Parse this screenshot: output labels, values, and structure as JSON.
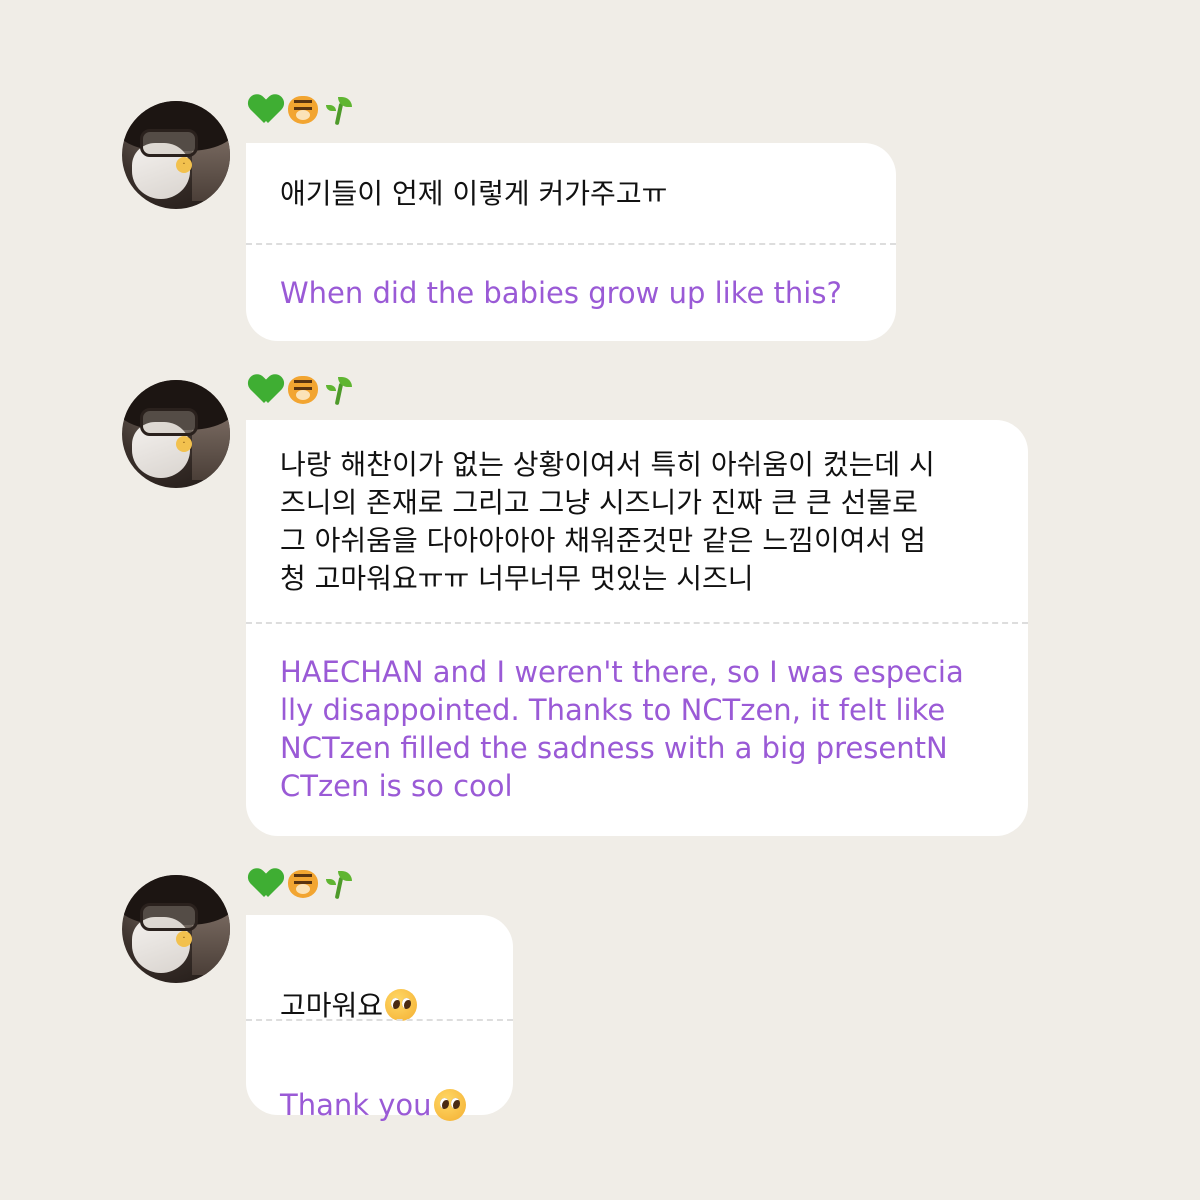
{
  "background_color": "#f0ede7",
  "accent_color": "#9a5ad6",
  "reaction_icons": [
    "green-heart-icon",
    "tiger-face-icon",
    "seedling-icon"
  ],
  "messages": [
    {
      "korean": "애기들이 언제 이렇게 커가주고ㅠ",
      "english": "When did the babies grow up like this?"
    },
    {
      "korean": "나랑 해찬이가 없는 상황이여서 특히 아쉬움이 컸는데 시\n즈니의 존재로 그리고 그냥 시즈니가 진짜 큰 큰 선물로\n그 아쉬움을 다아아아아 채워준것만 같은 느낌이여서 엄\n청 고마워요ㅠㅠ 너무너무 멋있는 시즈니",
      "english": "HAECHAN and I weren't there, so I was especia\nlly disappointed. Thanks to NCTzen, it felt like\nNCTzen filled the sadness with a big presentN\nCTzen is so cool"
    },
    {
      "korean": "고마워요",
      "english": "Thank you"
    }
  ]
}
